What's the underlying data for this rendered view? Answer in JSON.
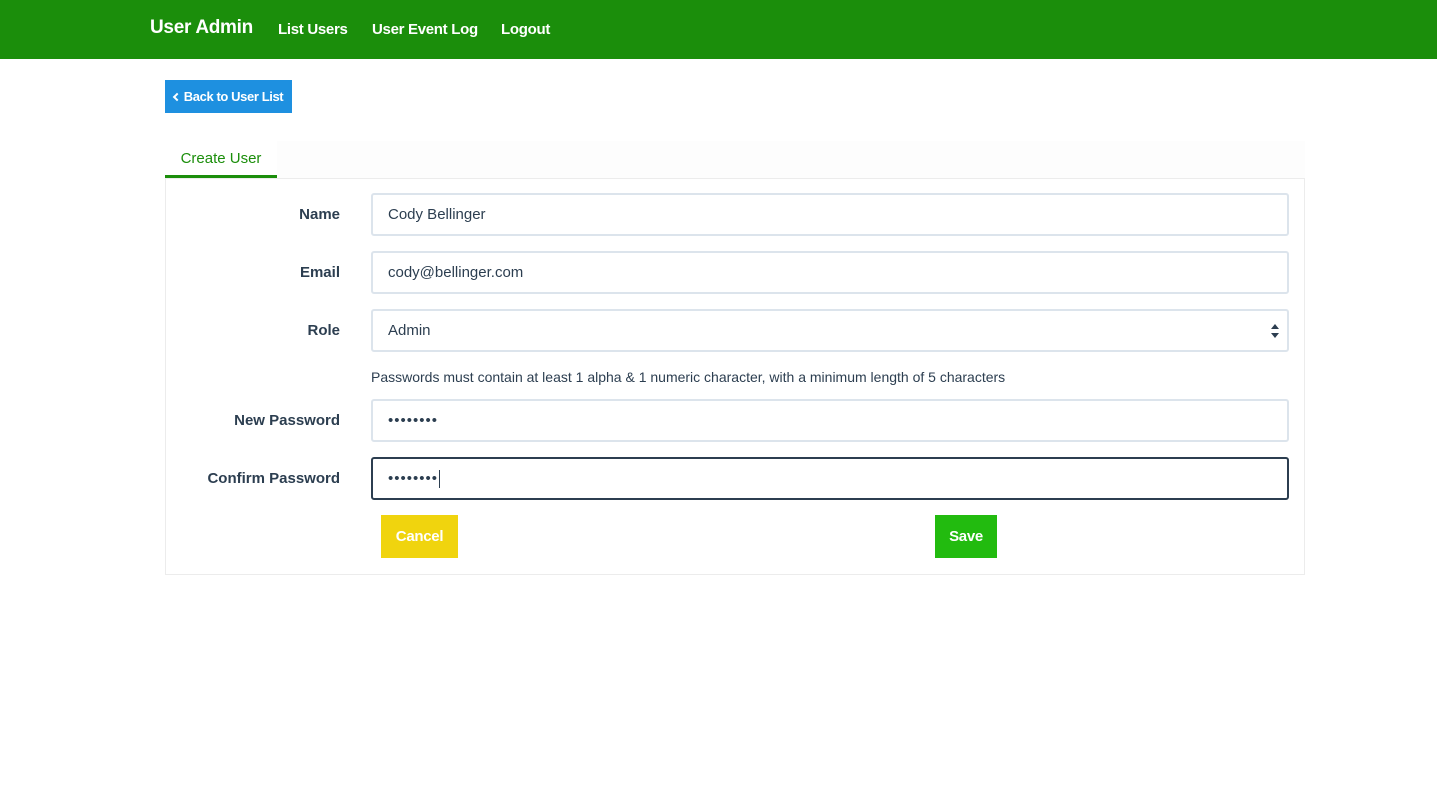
{
  "navbar": {
    "brand": "User Admin",
    "links": [
      "List Users",
      "User Event Log",
      "Logout"
    ],
    "bg_color": "#1b8e0b"
  },
  "back_button": {
    "label": "Back to User List",
    "icon": "chevron-left-icon"
  },
  "tabs": [
    {
      "label": "Create User",
      "active": true
    }
  ],
  "form": {
    "name": {
      "label": "Name",
      "value": "Cody Bellinger"
    },
    "email": {
      "label": "Email",
      "value": "cody@bellinger.com"
    },
    "role": {
      "label": "Role",
      "value": "Admin"
    },
    "password_help": "Passwords must contain at least 1 alpha & 1 numeric character, with a minimum length of 5 characters",
    "new_password": {
      "label": "New Password",
      "value": "••••••••"
    },
    "confirm_password": {
      "label": "Confirm Password",
      "value": "••••••••"
    }
  },
  "actions": {
    "cancel": "Cancel",
    "save": "Save",
    "cancel_color": "#f0d40e",
    "save_color": "#22bb0f"
  }
}
